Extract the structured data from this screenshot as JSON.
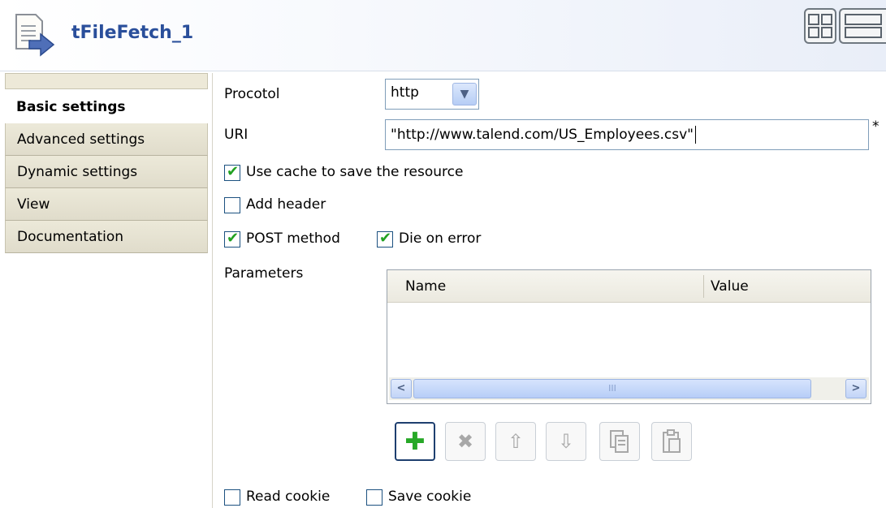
{
  "header": {
    "title": "tFileFetch_1",
    "component_icon": "file-fetch-icon"
  },
  "sidebar": {
    "items": [
      {
        "label": "Basic settings"
      },
      {
        "label": "Advanced settings"
      },
      {
        "label": "Dynamic settings"
      },
      {
        "label": "View"
      },
      {
        "label": "Documentation"
      }
    ]
  },
  "form": {
    "protocol": {
      "label": "Procotol",
      "value": "http"
    },
    "uri": {
      "label": "URI",
      "value": "\"http://www.talend.com/US_Employees.csv\"",
      "required_mark": "*"
    },
    "use_cache": {
      "label": "Use cache to save the resource",
      "checked": true
    },
    "add_header": {
      "label": "Add header",
      "checked": false
    },
    "post_method": {
      "label": "POST method",
      "checked": true
    },
    "die_on_error": {
      "label": "Die on error",
      "checked": true
    },
    "parameters": {
      "label": "Parameters",
      "columns": [
        "Name",
        "Value"
      ],
      "scroll_thumb_glyph": "III"
    },
    "read_cookie": {
      "label": "Read cookie",
      "checked": false
    },
    "save_cookie": {
      "label": "Save cookie",
      "checked": false
    }
  },
  "toolbar": {
    "buttons": [
      "add-icon",
      "delete-icon",
      "move-up-icon",
      "move-down-icon",
      "copy-icon",
      "paste-icon"
    ]
  },
  "colors": {
    "title": "#2a4f9b",
    "check": "#21a121",
    "tab_bg": "#ece9d9"
  }
}
